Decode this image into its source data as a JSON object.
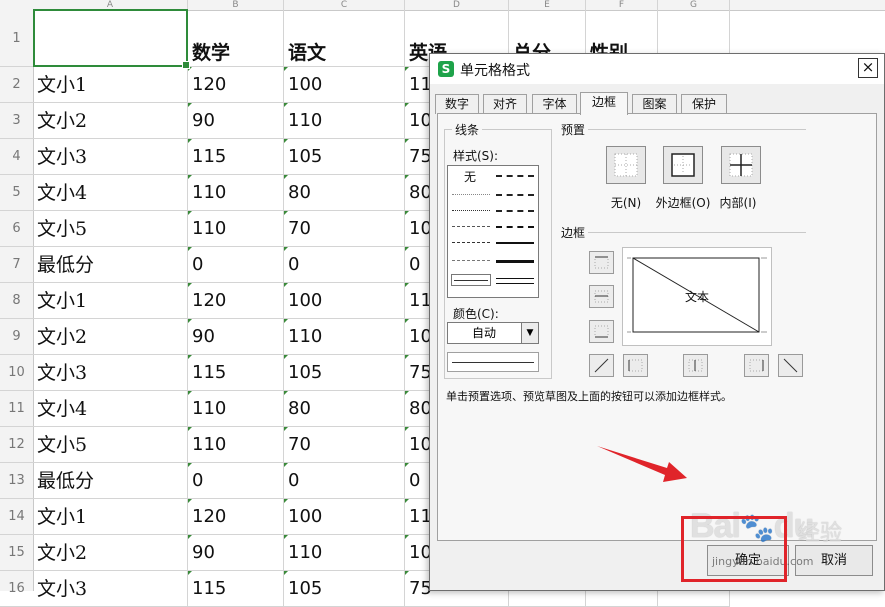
{
  "sheet": {
    "columns": [
      "A",
      "B",
      "C",
      "D",
      "E",
      "F",
      "G"
    ],
    "header_row": [
      "",
      "数学",
      "语文",
      "英语",
      "总分",
      "性别"
    ],
    "rows": [
      [
        "文小1",
        "120",
        "100",
        "11"
      ],
      [
        "文小2",
        "90",
        "110",
        "10"
      ],
      [
        "文小3",
        "115",
        "105",
        "75"
      ],
      [
        "文小4",
        "110",
        "80",
        "80"
      ],
      [
        "文小5",
        "110",
        "70",
        "10"
      ],
      [
        "最低分",
        "0",
        "0",
        "0"
      ],
      [
        "文小1",
        "120",
        "100",
        "11"
      ],
      [
        "文小2",
        "90",
        "110",
        "10"
      ],
      [
        "文小3",
        "115",
        "105",
        "75"
      ],
      [
        "文小4",
        "110",
        "80",
        "80"
      ],
      [
        "文小5",
        "110",
        "70",
        "10"
      ],
      [
        "最低分",
        "0",
        "0",
        "0"
      ],
      [
        "文小1",
        "120",
        "100",
        "11"
      ],
      [
        "文小2",
        "90",
        "110",
        "10"
      ],
      [
        "文小3",
        "115",
        "105",
        "75"
      ]
    ],
    "row_numbers": [
      "1",
      "2",
      "3",
      "4",
      "5",
      "6",
      "7",
      "8",
      "9",
      "10",
      "11",
      "12",
      "13",
      "14",
      "15",
      "16"
    ]
  },
  "dialog": {
    "title": "单元格格式",
    "app_icon": "S",
    "close": "×",
    "tabs": [
      "数字",
      "对齐",
      "字体",
      "边框",
      "图案",
      "保护"
    ],
    "active_tab": "边框",
    "line_group": "线条",
    "style_label": "样式(S):",
    "none_style": "无",
    "color_label": "颜色(C):",
    "color_value": "自动",
    "preset_group": "预置",
    "presets": [
      "无(N)",
      "外边框(O)",
      "内部(I)"
    ],
    "border_group": "边框",
    "preview_text": "文本",
    "hint": "单击预置选项、预览草图及上面的按钮可以添加边框样式。",
    "ok": "确定",
    "cancel": "取消"
  },
  "watermark": {
    "logo": "Bai",
    "logo_suffix": "du",
    "cn": "经验",
    "url": "jingyan.baidu.com"
  },
  "colors": {
    "selection": "#2e8b3a",
    "highlight": "#e0242a",
    "app_icon": "#1ea34a"
  }
}
